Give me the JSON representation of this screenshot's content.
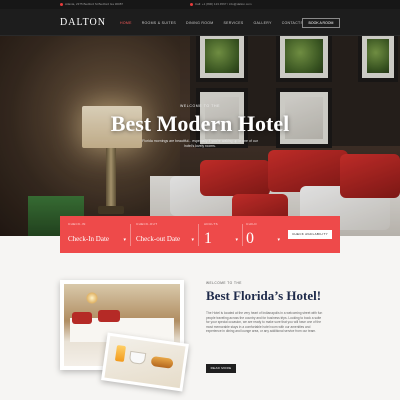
{
  "topbar": {
    "address": "Atlanta, 2375 Bedford St Bedford Ga 30087",
    "phone": "Call: +1 (800) 123 4567 / info@dalton.com"
  },
  "nav": {
    "logo": "DALTON",
    "menu": [
      {
        "label": "HOME",
        "active": true
      },
      {
        "label": "ROOMS & SUITES",
        "active": false
      },
      {
        "label": "DINING ROOM",
        "active": false
      },
      {
        "label": "SERVICES",
        "active": false
      },
      {
        "label": "GALLERY",
        "active": false
      },
      {
        "label": "CONTACTS",
        "active": false
      }
    ],
    "book_button": "BOOK A ROOM"
  },
  "hero": {
    "welcome": "WELCOME TO THE",
    "title": "Best Modern Hotel",
    "subtitle": "Florida mornings are beautiful... especially if you're waking up in one of our hotel's lovely rooms."
  },
  "booking": {
    "checkin_label": "CHECK-IN",
    "checkin_value": "Check-In Date",
    "checkout_label": "CHECK-OUT",
    "checkout_value": "Check-out Date",
    "adults_label": "ADULTS",
    "adults_value": "1",
    "child_label": "CHILD",
    "child_value": "0",
    "button": "CHECK AVAILABILITY"
  },
  "about": {
    "kicker": "WELCOME TO THE",
    "title": "Best Florida’s Hotel!",
    "text": "The Hotel is located at the very heart of Indianapolis in a welcoming street with fun people traveling across the country and for business trips. Looking to book a suite for your special occasion, we are ready to make sure that you will have one of the most memorable stays in a comfortable hotel room with our amenities and experience in dining and lounge area, or any additional service from our team.",
    "button": "READ MORE"
  },
  "colors": {
    "accent": "#ee4a4a",
    "dark": "#1d1d1d",
    "title_blue": "#1e2a4a"
  }
}
